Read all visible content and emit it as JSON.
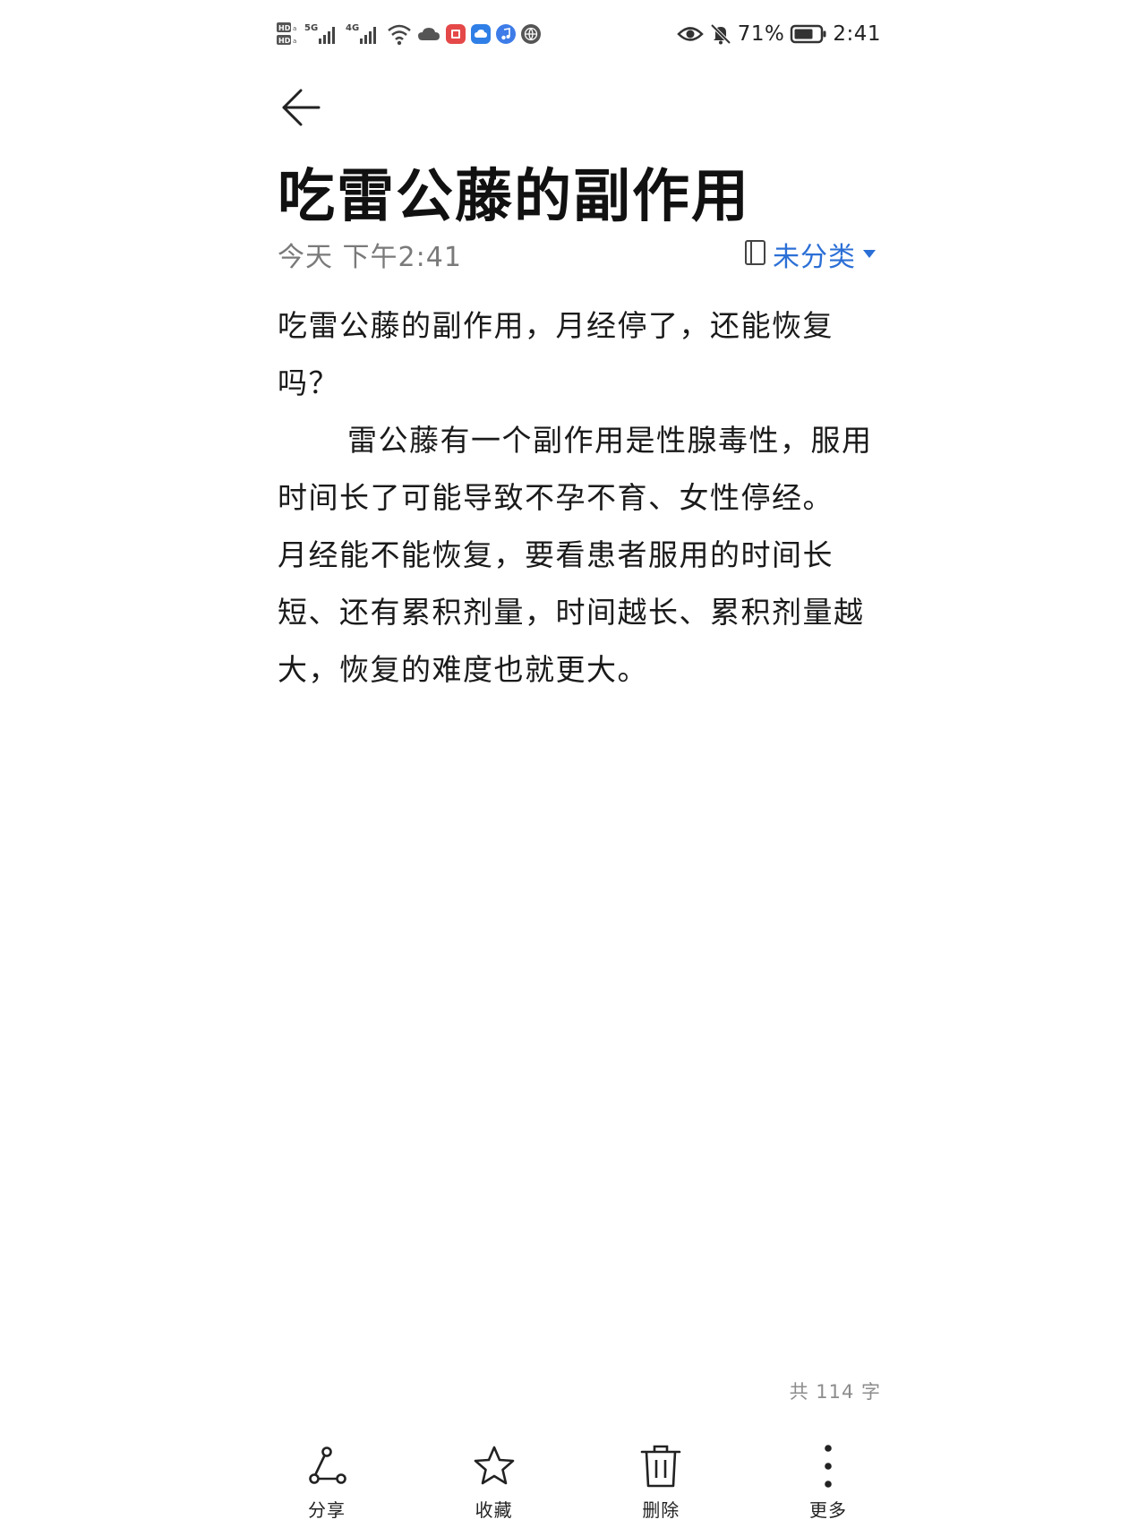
{
  "status_bar": {
    "battery_percent": "71%",
    "time": "2:41",
    "network_1": "5G",
    "network_2": "4G",
    "hd_label": "HD",
    "left_icons": [
      "hd-icon",
      "signal-5g-icon",
      "signal-4g-icon",
      "wifi-icon",
      "cloud-icon",
      "red-app-icon",
      "blue-cloud-app-icon",
      "music-app-icon",
      "globe-app-icon"
    ],
    "right_icons": [
      "eye-icon",
      "bell-muted-icon",
      "battery-icon"
    ]
  },
  "header": {
    "back_icon": "arrow-left-icon"
  },
  "note": {
    "title": "吃雷公藤的副作用",
    "date": "今天 下午2:41",
    "category": "未分类",
    "category_icon": "notebook-icon",
    "dropdown_icon": "triangle-down-icon",
    "accent_color": "#2b6fd6",
    "paragraph_1": "吃雷公藤的副作用，月经停了，还能恢复吗？",
    "paragraph_2": "雷公藤有一个副作用是性腺毒性，服用时间长了可能导致不孕不育、女性停经。",
    "paragraph_3": "月经能不能恢复，要看患者服用的时间长短、还有累积剂量，时间越长、累积剂量越大，恢复的难度也就更大。",
    "word_count": "共 114 字"
  },
  "toolbar": {
    "share_label": "分享",
    "share_icon": "share-icon",
    "favorite_label": "收藏",
    "favorite_icon": "star-icon",
    "delete_label": "删除",
    "delete_icon": "trash-icon",
    "more_label": "更多",
    "more_icon": "more-vertical-icon"
  }
}
